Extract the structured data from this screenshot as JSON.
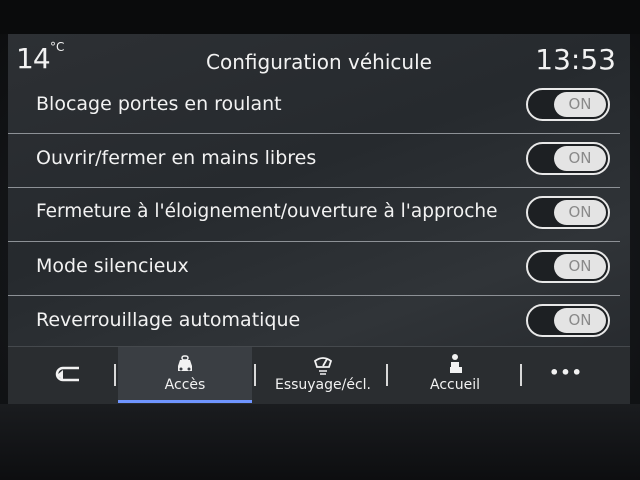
{
  "header": {
    "temperature": "14",
    "temperature_unit": "°C",
    "title": "Configuration véhicule",
    "time": "13:53"
  },
  "settings": [
    {
      "label": "Blocage portes en roulant",
      "toggle": "ON"
    },
    {
      "label": "Ouvrir/fermer en mains libres",
      "toggle": "ON"
    },
    {
      "label": "Fermeture à l'éloignement/ouverture à l'approche",
      "toggle": "ON"
    },
    {
      "label": "Mode silencieux",
      "toggle": "ON"
    },
    {
      "label": "Reverrouillage automatique",
      "toggle": "ON"
    }
  ],
  "nav": {
    "back_icon": "back-arrow-icon",
    "tabs": [
      {
        "label": "Accès",
        "icon": "car-lock-icon",
        "active": true
      },
      {
        "label": "Essuyage/écl.",
        "icon": "wiper-light-icon",
        "active": false
      },
      {
        "label": "Accueil",
        "icon": "person-seat-icon",
        "active": false
      }
    ],
    "more_label": "•••"
  },
  "colors": {
    "active_tab_underline": "#6f95ff",
    "toggle_knob": "#e4e4e4"
  }
}
